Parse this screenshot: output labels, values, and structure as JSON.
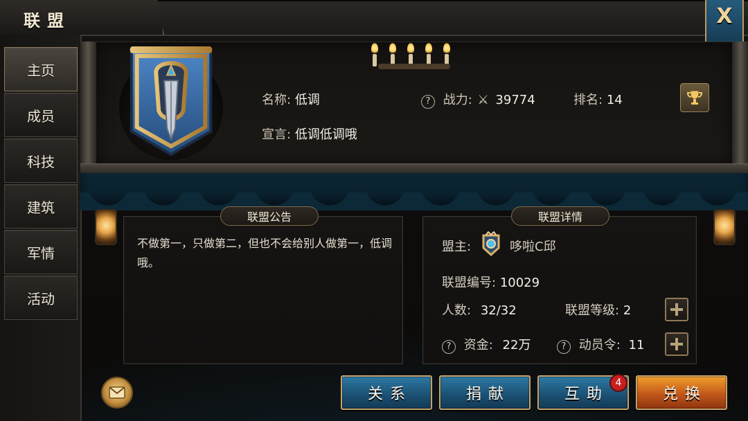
{
  "window": {
    "title": "联盟",
    "close_label": "X"
  },
  "sidebar": {
    "items": [
      {
        "label": "主页"
      },
      {
        "label": "成员"
      },
      {
        "label": "科技"
      },
      {
        "label": "建筑"
      },
      {
        "label": "军情"
      },
      {
        "label": "活动"
      }
    ],
    "active_index": 0
  },
  "alliance": {
    "name_label": "名称:",
    "name": "低调",
    "power_label": "战力:",
    "power": "39774",
    "rank_label": "排名:",
    "rank": "14",
    "declaration_label": "宣言:",
    "declaration": "低调低调哦"
  },
  "announcement": {
    "title": "联盟公告",
    "text": "不做第一，只做第二，但也不会给别人做第一，低调哦。"
  },
  "details": {
    "title": "联盟详情",
    "leader_label": "盟主:",
    "leader_name": "哆啦C邱",
    "id_label": "联盟编号:",
    "id": "10029",
    "members_label": "人数:",
    "members": "32/32",
    "level_label": "联盟等级:",
    "level": "2",
    "funds_label": "资金:",
    "funds": "22万",
    "mobilize_label": "动员令:",
    "mobilize": "11"
  },
  "actions": {
    "relations": "关系",
    "donate": "捐献",
    "mutual_aid": "互助",
    "mutual_aid_badge": "4",
    "exchange": "兑换"
  },
  "colors": {
    "gold_border": "#c7a36a",
    "button_blue": "#1b4f72",
    "button_orange": "#c1581a",
    "panel_bg": "#161412"
  },
  "icons": {
    "close": "close-icon",
    "help": "help-icon",
    "power": "crossed-swords-icon",
    "trophy": "trophy-icon",
    "mail": "mail-icon",
    "plus": "plus-icon"
  }
}
